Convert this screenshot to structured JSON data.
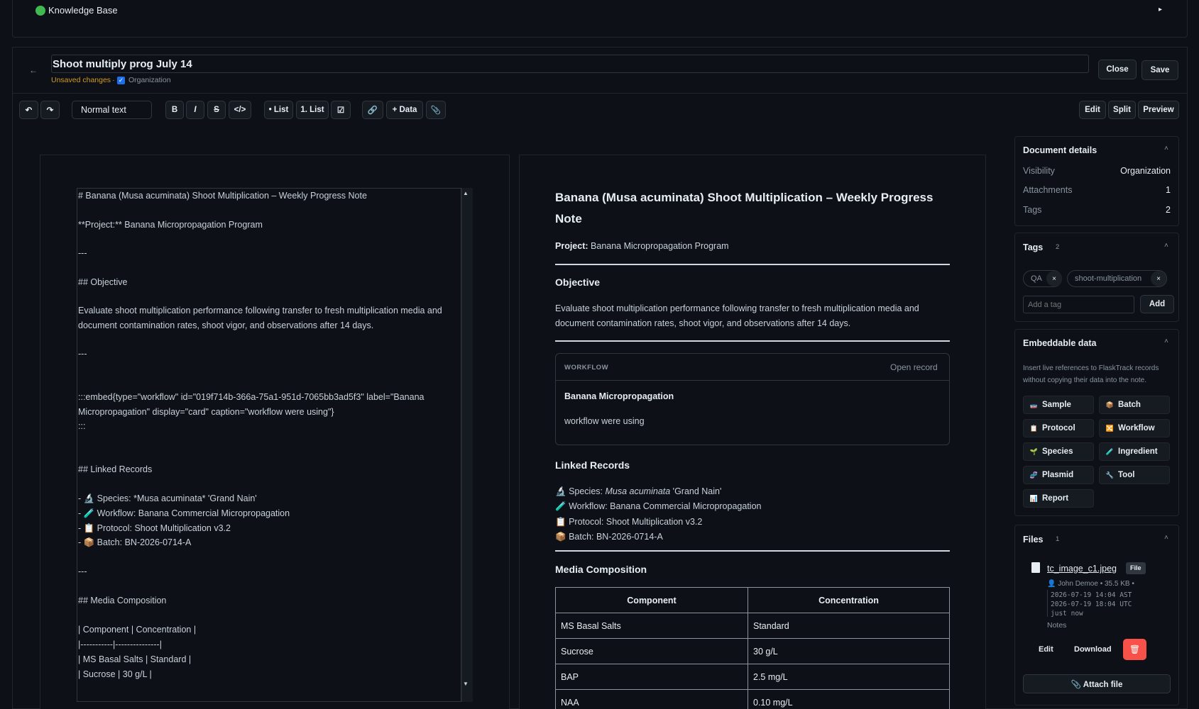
{
  "topbar": {
    "title": "Knowledge Base",
    "toggle_icon": "▸"
  },
  "header": {
    "back_icon": "←",
    "title": "Shoot multiply prog July 14",
    "unsaved": "Unsaved changes",
    "separator": "·",
    "visibility": "Organization",
    "close_label": "Close",
    "save_label": "Save"
  },
  "toolbar": {
    "undo": "↶",
    "redo": "↷",
    "text_style": "Normal text",
    "bold": "B",
    "italic": "I",
    "strike": "S",
    "code": "</>",
    "bullet_list": "• List",
    "numbered_list": "1. List",
    "checklist": "☑",
    "link": "🔗",
    "data": "+ Data",
    "attach": "📎",
    "view_edit": "Edit",
    "view_split": "Split",
    "view_preview": "Preview"
  },
  "editor": {
    "lines": [
      "# Banana (Musa acuminata) Shoot Multiplication – Weekly Progress Note",
      "**Project:** Banana Micropropagation Program",
      "---",
      "## Objective",
      "Evaluate shoot multiplication performance following transfer to fresh multiplication media and",
      "document contamination rates, shoot vigor, and observations after 14 days.",
      "---",
      ":::embed{type=\"workflow\" id=\"019f714b-366a-75a1-951d-7065bb3ad5f3\" label=\"Banana",
      "Micropropagation\" display=\"card\" caption=\"workflow were using\"}",
      ":::",
      "## Linked Records",
      "- 🔬 Species: *Musa acuminata* 'Grand Nain'",
      "- 🧪 Workflow: Banana Commercial Micropropagation",
      "- 📋 Protocol: Shoot Multiplication v3.2",
      "- 📦 Batch: BN-2026-0714-A",
      "---",
      "## Media Composition",
      "| Component | Concentration |",
      "|-----------|---------------|",
      "| MS Basal Salts | Standard |",
      "| Sucrose | 30 g/L |"
    ]
  },
  "preview": {
    "h1": "Banana (Musa acuminata) Shoot Multiplication – Weekly Progress Note",
    "project_label": "Project:",
    "project_value": "Banana Micropropagation Program",
    "objective_h": "Objective",
    "objective_text": "Evaluate shoot multiplication performance following transfer to fresh multiplication media and document contamination rates, shoot vigor, and observations after 14 days.",
    "embed": {
      "type_label": "WORKFLOW",
      "open_link": "Open record",
      "title": "Banana Micropropagation",
      "caption": "workflow were using"
    },
    "linked_h": "Linked Records",
    "linked": [
      {
        "icon": "🔬",
        "prefix": "Species: ",
        "italic": "Musa acuminata",
        "suffix": " 'Grand Nain'"
      },
      {
        "icon": "🧪",
        "prefix": "Workflow: Banana Commercial Micropropagation",
        "italic": "",
        "suffix": ""
      },
      {
        "icon": "📋",
        "prefix": "Protocol: Shoot Multiplication v3.2",
        "italic": "",
        "suffix": ""
      },
      {
        "icon": "📦",
        "prefix": "Batch: BN-2026-0714-A",
        "italic": "",
        "suffix": ""
      }
    ],
    "media_h": "Media Composition",
    "table": {
      "headers": [
        "Component",
        "Concentration"
      ],
      "rows": [
        [
          "MS Basal Salts",
          "Standard"
        ],
        [
          "Sucrose",
          "30 g/L"
        ],
        [
          "BAP",
          "2.5 mg/L"
        ],
        [
          "NAA",
          "0.10 mg/L"
        ]
      ]
    }
  },
  "sidebar": {
    "details": {
      "title": "Document details",
      "rows": [
        {
          "key": "Visibility",
          "value": "Organization"
        },
        {
          "key": "Attachments",
          "value": "1"
        },
        {
          "key": "Tags",
          "value": "2"
        }
      ]
    },
    "tags": {
      "title": "Tags",
      "count": "2",
      "items": [
        "QA",
        "shoot-multiplication"
      ],
      "remove_icon": "×",
      "input_placeholder": "Add a tag",
      "add_label": "Add"
    },
    "embeddable": {
      "title": "Embeddable data",
      "description_1": "Insert live references to FlaskTrack records",
      "description_2": "without copying their data into the note.",
      "buttons": [
        {
          "label": "Sample",
          "icon": "🧫",
          "color": "#8b5cf6"
        },
        {
          "label": "Batch",
          "icon": "📦",
          "color": "#d29922"
        },
        {
          "label": "Protocol",
          "icon": "📋",
          "color": "#e6edf3"
        },
        {
          "label": "Workflow",
          "icon": "🔀",
          "color": "#f0883e"
        },
        {
          "label": "Species",
          "icon": "🌱",
          "color": "#3fb950"
        },
        {
          "label": "Ingredient",
          "icon": "🧪",
          "color": "#58a6ff"
        },
        {
          "label": "Plasmid",
          "icon": "🧬",
          "color": "#58a6ff"
        },
        {
          "label": "Tool",
          "icon": "🔧",
          "color": "#8b949e"
        },
        {
          "label": "Report",
          "icon": "📊",
          "color": "#58a6ff"
        }
      ]
    },
    "files": {
      "title": "Files",
      "count": "1",
      "file_name": "tc_image_c1.jpeg",
      "file_badge": "File",
      "meta": "👤 John Demoe • 35.5 KB •",
      "time_1": "2026-07-19 14:04 AST",
      "time_2": "2026-07-19 18:04 UTC",
      "time_3": "just now",
      "notes": "Notes",
      "edit_label": "Edit",
      "download_label": "Download",
      "delete_icon": "🗑",
      "attach_label": "📎 Attach file"
    },
    "collapse_icon": "˄"
  }
}
